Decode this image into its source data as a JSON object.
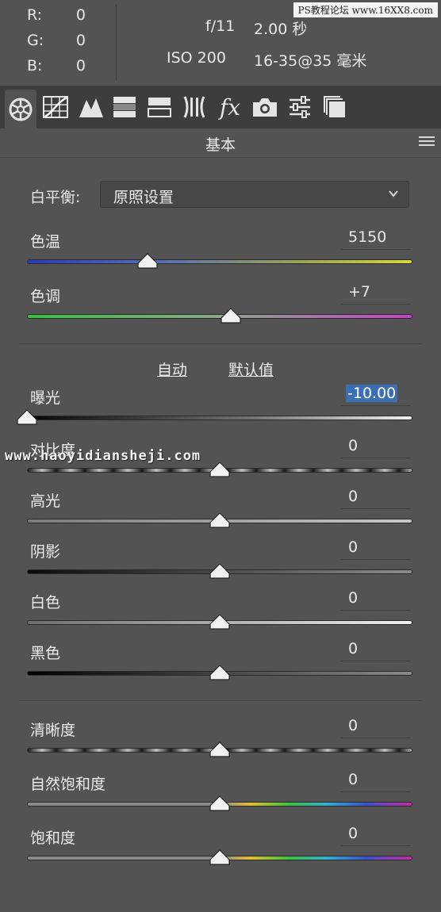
{
  "info": {
    "rgb": [
      {
        "label": "R:",
        "value": "0"
      },
      {
        "label": "G:",
        "value": "0"
      },
      {
        "label": "B:",
        "value": "0"
      }
    ],
    "camera": {
      "aperture": "f/11",
      "shutter": "2.00 秒",
      "iso": "ISO 200",
      "lens": "16-35@35 毫米"
    }
  },
  "watermark_top": "PS教程论坛 www.16XX8.com",
  "watermark_mid": "www.haoyidiansheji.com",
  "toolbar": {
    "tools": [
      {
        "name": "basic-tool-icon",
        "fx": ""
      },
      {
        "name": "tone-curve-icon",
        "fx": ""
      },
      {
        "name": "detail-icon",
        "fx": ""
      },
      {
        "name": "hsl-icon",
        "fx": ""
      },
      {
        "name": "split-toning-icon",
        "fx": ""
      },
      {
        "name": "lens-corrections-icon",
        "fx": ""
      },
      {
        "name": "effects-icon",
        "fx": "fx"
      },
      {
        "name": "camera-calibration-icon",
        "fx": ""
      },
      {
        "name": "presets-icon",
        "fx": ""
      },
      {
        "name": "snapshots-icon",
        "fx": ""
      }
    ]
  },
  "panel": {
    "title": "基本",
    "wb_label": "白平衡:",
    "wb_value": "原照设置",
    "auto_label": "自动",
    "default_label": "默认值",
    "sliders": [
      {
        "id": "temperature",
        "label": "色温",
        "value": "5150",
        "pos": 0.313,
        "track": "temp"
      },
      {
        "id": "tint",
        "label": "色调",
        "value": "+7",
        "pos": 0.529,
        "track": "tint"
      },
      {
        "id": "exposure",
        "label": "曝光",
        "value": "-10.00",
        "pos": 0.0,
        "track": "exposure",
        "selected": true
      },
      {
        "id": "contrast",
        "label": "对比度",
        "value": "0",
        "pos": 0.5,
        "track": "contrast"
      },
      {
        "id": "highlights",
        "label": "高光",
        "value": "0",
        "pos": 0.5,
        "track": "highlights"
      },
      {
        "id": "shadows",
        "label": "阴影",
        "value": "0",
        "pos": 0.5,
        "track": "shadows"
      },
      {
        "id": "whites",
        "label": "白色",
        "value": "0",
        "pos": 0.5,
        "track": "whites"
      },
      {
        "id": "blacks",
        "label": "黑色",
        "value": "0",
        "pos": 0.5,
        "track": "blacks"
      },
      {
        "id": "clarity",
        "label": "清晰度",
        "value": "0",
        "pos": 0.5,
        "track": "contrast"
      },
      {
        "id": "vibrance",
        "label": "自然饱和度",
        "value": "0",
        "pos": 0.5,
        "track": "saturation"
      },
      {
        "id": "saturation",
        "label": "饱和度",
        "value": "0",
        "pos": 0.5,
        "track": "saturation"
      }
    ]
  },
  "colors": {
    "panel_bg": "#535353",
    "toolbar_bg": "#3d3d3d",
    "selection": "#3b6fb3"
  }
}
